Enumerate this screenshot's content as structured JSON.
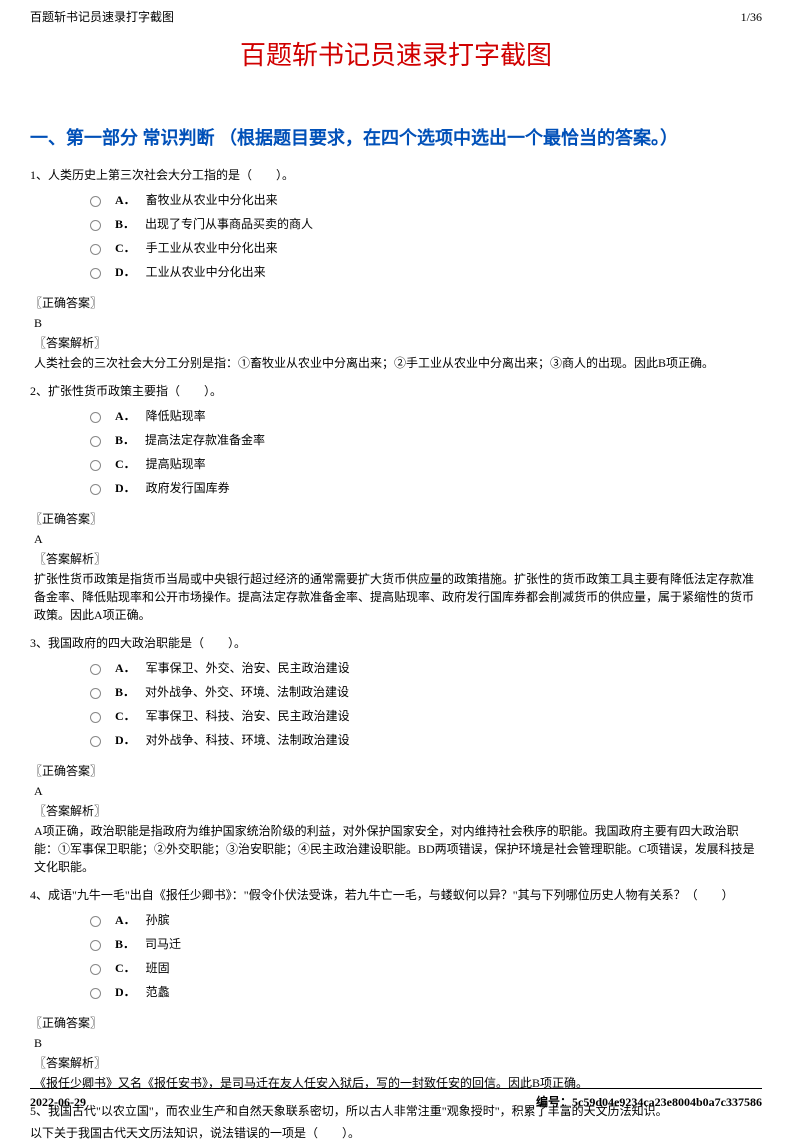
{
  "header": {
    "doc_title_small": "百题斩书记员速录打字截图",
    "page_indicator": "1/36"
  },
  "main_title": "百题斩书记员速录打字截图",
  "section_title": "一、第一部分 常识判断 （根据题目要求，在四个选项中选出一个最恰当的答案。）",
  "questions": [
    {
      "stem": "1、人类历史上第三次社会大分工指的是（　　）。",
      "options": [
        {
          "label": "A．",
          "text": "畜牧业从农业中分化出来"
        },
        {
          "label": "B．",
          "text": "出现了专门从事商品买卖的商人"
        },
        {
          "label": "C．",
          "text": "手工业从农业中分化出来"
        },
        {
          "label": "D．",
          "text": "工业从农业中分化出来"
        }
      ],
      "answer_header": "〖正确答案〗",
      "answer": "B",
      "explain_header": "〖答案解析〗",
      "explain": "人类社会的三次社会大分工分别是指：①畜牧业从农业中分离出来；②手工业从农业中分离出来；③商人的出现。因此B项正确。"
    },
    {
      "stem": "2、扩张性货币政策主要指（　　）。",
      "options": [
        {
          "label": "A．",
          "text": "降低贴现率"
        },
        {
          "label": "B．",
          "text": "提高法定存款准备金率"
        },
        {
          "label": "C．",
          "text": "提高贴现率"
        },
        {
          "label": "D．",
          "text": "政府发行国库券"
        }
      ],
      "answer_header": "〖正确答案〗",
      "answer": "A",
      "explain_header": "〖答案解析〗",
      "explain": "扩张性货币政策是指货币当局或中央银行超过经济的通常需要扩大货币供应量的政策措施。扩张性的货币政策工具主要有降低法定存款准备金率、降低贴现率和公开市场操作。提高法定存款准备金率、提高贴现率、政府发行国库券都会削减货币的供应量，属于紧缩性的货币政策。因此A项正确。"
    },
    {
      "stem": "3、我国政府的四大政治职能是（　　）。",
      "options": [
        {
          "label": "A．",
          "text": "军事保卫、外交、治安、民主政治建设"
        },
        {
          "label": "B．",
          "text": "对外战争、外交、环境、法制政治建设"
        },
        {
          "label": "C．",
          "text": "军事保卫、科技、治安、民主政治建设"
        },
        {
          "label": "D．",
          "text": "对外战争、科技、环境、法制政治建设"
        }
      ],
      "answer_header": "〖正确答案〗",
      "answer": "A",
      "explain_header": "〖答案解析〗",
      "explain": "A项正确，政治职能是指政府为维护国家统治阶级的利益，对外保护国家安全，对内维持社会秩序的职能。我国政府主要有四大政治职能：①军事保卫职能；②外交职能；③治安职能；④民主政治建设职能。BD两项错误，保护环境是社会管理职能。C项错误，发展科技是文化职能。"
    },
    {
      "stem": "4、成语\"九牛一毛\"出自《报任少卿书》：\"假令仆伏法受诛，若九牛亡一毛，与蝼蚁何以异？\"其与下列哪位历史人物有关系？（　　）",
      "options": [
        {
          "label": "A．",
          "text": "孙膑"
        },
        {
          "label": "B．",
          "text": "司马迁"
        },
        {
          "label": "C．",
          "text": "班固"
        },
        {
          "label": "D．",
          "text": "范蠡"
        }
      ],
      "answer_header": "〖正确答案〗",
      "answer": "B",
      "explain_header": "〖答案解析〗",
      "explain": "《报任少卿书》又名《报任安书》，是司马迁在友人任安入狱后，写的一封致任安的回信。因此B项正确。"
    }
  ],
  "trailing": {
    "line1": "5、我国古代\"以农立国\"，而农业生产和自然天象联系密切，所以古人非常注重\"观象授时\"，积累了丰富的天文历法知识。",
    "line2": "以下关于我国古代天文历法知识，说法错误的一项是（　　）。"
  },
  "footer": {
    "date": "2022-06-29",
    "serial_label": "编号：",
    "serial": "5c59d04e9234ca23e8004b0a7c337586"
  }
}
